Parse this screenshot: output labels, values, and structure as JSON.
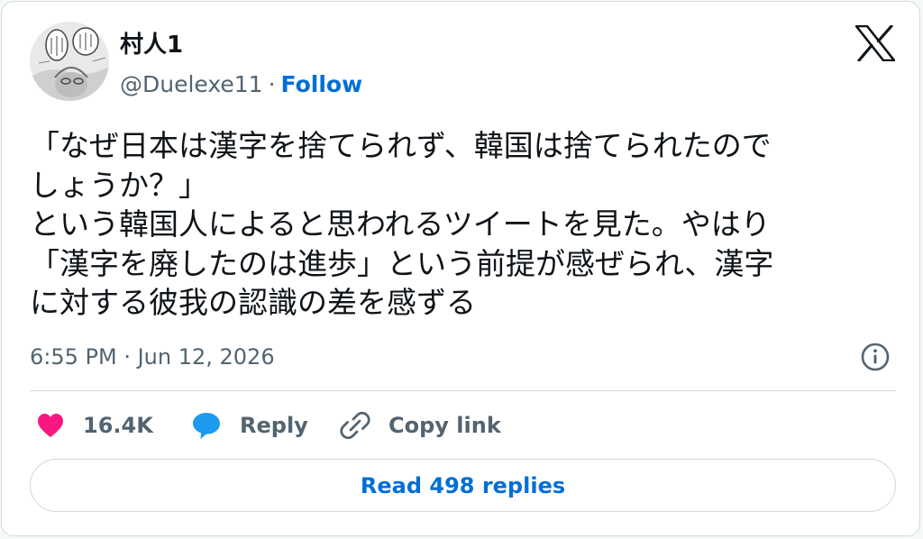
{
  "user": {
    "display_name": "村人1",
    "handle": "@Duelexe11",
    "separator": "·",
    "follow_label": "Follow"
  },
  "tweet": {
    "lines": [
      "「なぜ日本は漢字を捨てられず、韓国は捨てられたので",
      "しょうか？」",
      "という韓国人によると思われるツイートを見た。やはり",
      "「漢字を廃したのは進歩」という前提が感ぜられ、漢字",
      "に対する彼我の認識の差を感ずる"
    ],
    "timestamp": "6:55 PM · Jun 12, 2026"
  },
  "actions": {
    "like_count": "16.4K",
    "reply_label": "Reply",
    "copy_link_label": "Copy link"
  },
  "read_replies_label": "Read 498 replies",
  "colors": {
    "text": "#0f1419",
    "secondary": "#536471",
    "link_blue": "#006fd6",
    "heart": "#f91880",
    "reply_bubble": "#1d9bf0",
    "border": "#cfd9de"
  },
  "icons": [
    "x-logo-icon",
    "info-icon",
    "heart-icon",
    "reply-bubble-icon",
    "link-icon"
  ]
}
